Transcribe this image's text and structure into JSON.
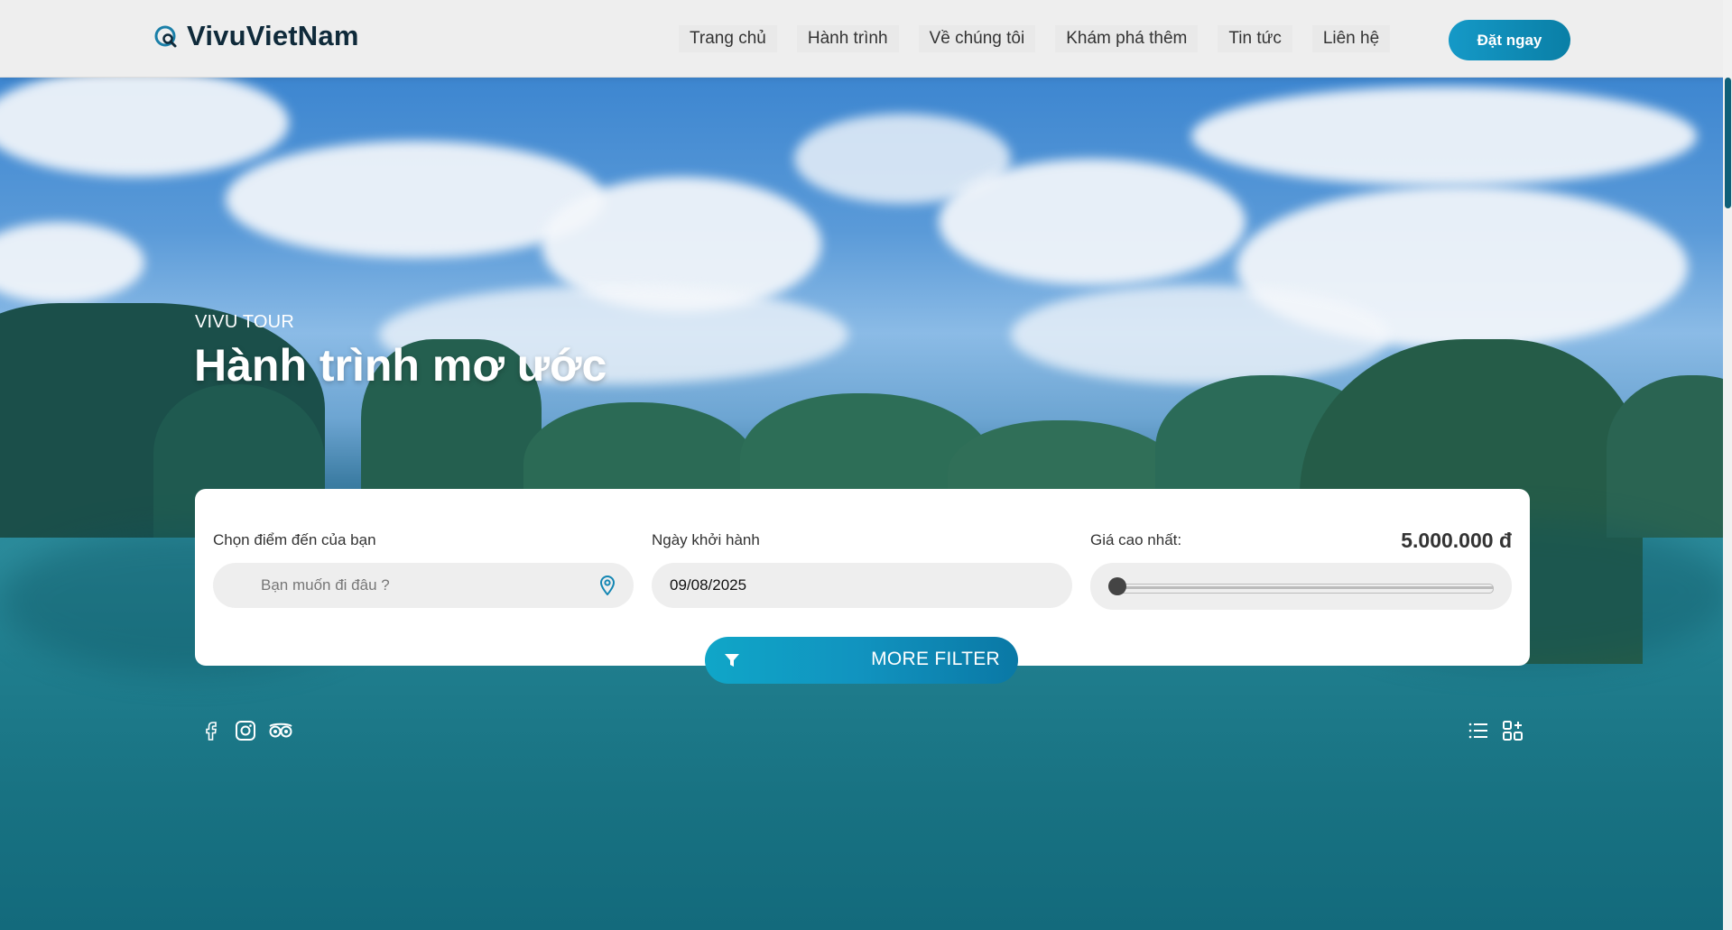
{
  "header": {
    "brand": "VivuVietNam",
    "nav": [
      "Trang chủ",
      "Hành trình",
      "Về chúng tôi",
      "Khám phá thêm",
      "Tin tức",
      "Liên hệ"
    ],
    "book_label": "Đặt ngay"
  },
  "hero": {
    "tag": "VIVU TOUR",
    "title": "Hành trình mơ ước"
  },
  "search": {
    "destination_label": "Chọn điểm đến của bạn",
    "destination_placeholder": "Bạn muốn đi đâu ?",
    "date_label": "Ngày khởi hành",
    "date_value": "09/08/2025",
    "price_label": "Giá cao nhất:",
    "price_value": "5.000.000 đ",
    "price_slider_level": 0,
    "more_filter_label": "MORE FILTER"
  },
  "icons": {
    "brand": "globe-search-icon",
    "pin": "map-pin-icon",
    "filter": "filter-icon",
    "social": [
      "facebook-icon",
      "instagram-icon",
      "tripadvisor-icon"
    ],
    "view": [
      "list-view-icon",
      "grid-view-icon"
    ]
  },
  "colors": {
    "accent": "#1599c7",
    "accent_dark": "#0a7fa6",
    "brand_text": "#0f2a3a"
  }
}
